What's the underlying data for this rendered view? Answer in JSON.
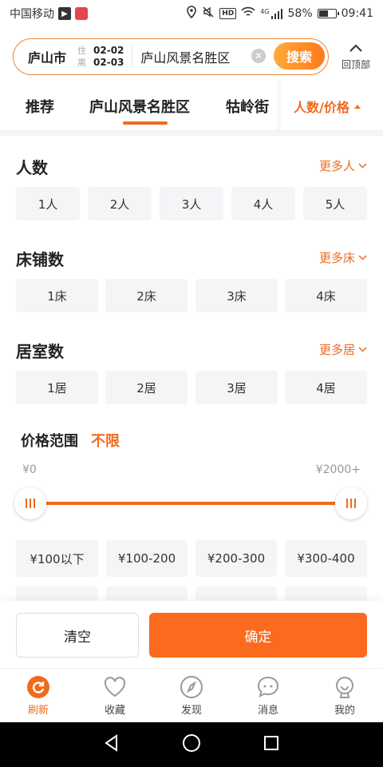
{
  "status": {
    "carrier": "中国移动",
    "battery": "58%",
    "battery_level": 0.58,
    "hd": "HD",
    "network": "4G",
    "time": "09:41"
  },
  "search": {
    "city": "庐山市",
    "checkin_key": "住",
    "checkin_date": "02-02",
    "checkout_key": "离",
    "checkout_date": "02-03",
    "keyword": "庐山风景名胜区",
    "button": "搜索",
    "back_top": "回顶部"
  },
  "tabs": {
    "recommend": "推荐",
    "scenic": "庐山风景名胜区",
    "street": "牯岭街",
    "people_price": "人数/价格"
  },
  "filters": {
    "people": {
      "title": "人数",
      "more": "更多人",
      "options": [
        "1人",
        "2人",
        "3人",
        "4人",
        "5人"
      ]
    },
    "beds": {
      "title": "床铺数",
      "more": "更多床",
      "options": [
        "1床",
        "2床",
        "3床",
        "4床"
      ]
    },
    "rooms": {
      "title": "居室数",
      "more": "更多居",
      "options": [
        "1居",
        "2居",
        "3居",
        "4居"
      ]
    },
    "price": {
      "title": "价格范围",
      "value": "不限",
      "min": "¥0",
      "max": "¥2000+",
      "range_low": 0,
      "range_high": 2000,
      "options": [
        "¥100以下",
        "¥100-200",
        "¥200-300",
        "¥300-400"
      ]
    }
  },
  "actions": {
    "clear": "清空",
    "confirm": "确定"
  },
  "bottom_nav": {
    "refresh": "刷新",
    "favorites": "收藏",
    "discover": "发现",
    "messages": "消息",
    "mine": "我的"
  },
  "colors": {
    "accent": "#f06a1c",
    "chip_bg": "#f4f5f7"
  }
}
